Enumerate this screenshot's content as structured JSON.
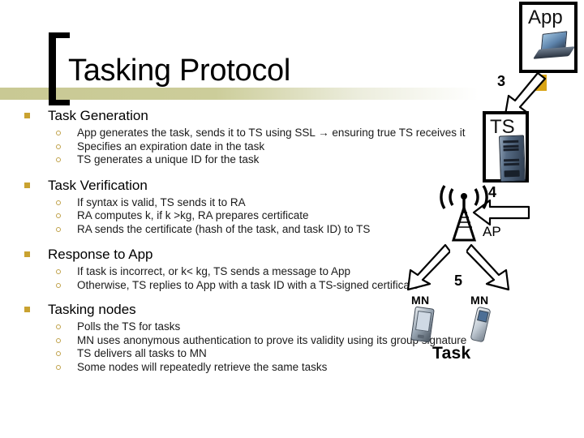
{
  "slide": {
    "title": "Tasking Protocol",
    "accent_color": "#d9a415",
    "band_color": "#c9c994",
    "bullet_square_color": "#c9a230",
    "bullet_circle_color": "#c0a24a"
  },
  "sections": [
    {
      "heading": "Task Generation",
      "items": [
        "App generates the task, sends it to TS using SSL → ensuring true TS receives it",
        "Specifies an expiration date in the task",
        "TS generates a unique ID for the task"
      ]
    },
    {
      "heading": "Task Verification",
      "items": [
        "If syntax is valid, TS sends it to RA",
        "RA computes k, if k >kg, RA prepares certificate",
        "RA sends the certificate (hash of the task, and task ID) to TS"
      ]
    },
    {
      "heading": "Response to App",
      "items": [
        "If task is incorrect, or k< kg, TS sends a message to App",
        "Otherwise, TS replies to App with a task ID with a TS-signed certificate"
      ]
    },
    {
      "heading": "Tasking nodes",
      "items": [
        "Polls the TS for tasks",
        "MN uses anonymous authentication to prove its validity using its group signature",
        "TS delivers all tasks to MN",
        "Some nodes will repeatedly retrieve the same tasks"
      ]
    }
  ],
  "diagram": {
    "app_node_label": "App",
    "ts_node_label": "TS",
    "ap_label": "AP",
    "mn_left_label": "MN",
    "mn_right_label": "MN",
    "task_label": "Task",
    "step_app_to_ts": "3",
    "step_ts_to_ap": "4",
    "step_ap_to_mn": "5"
  }
}
